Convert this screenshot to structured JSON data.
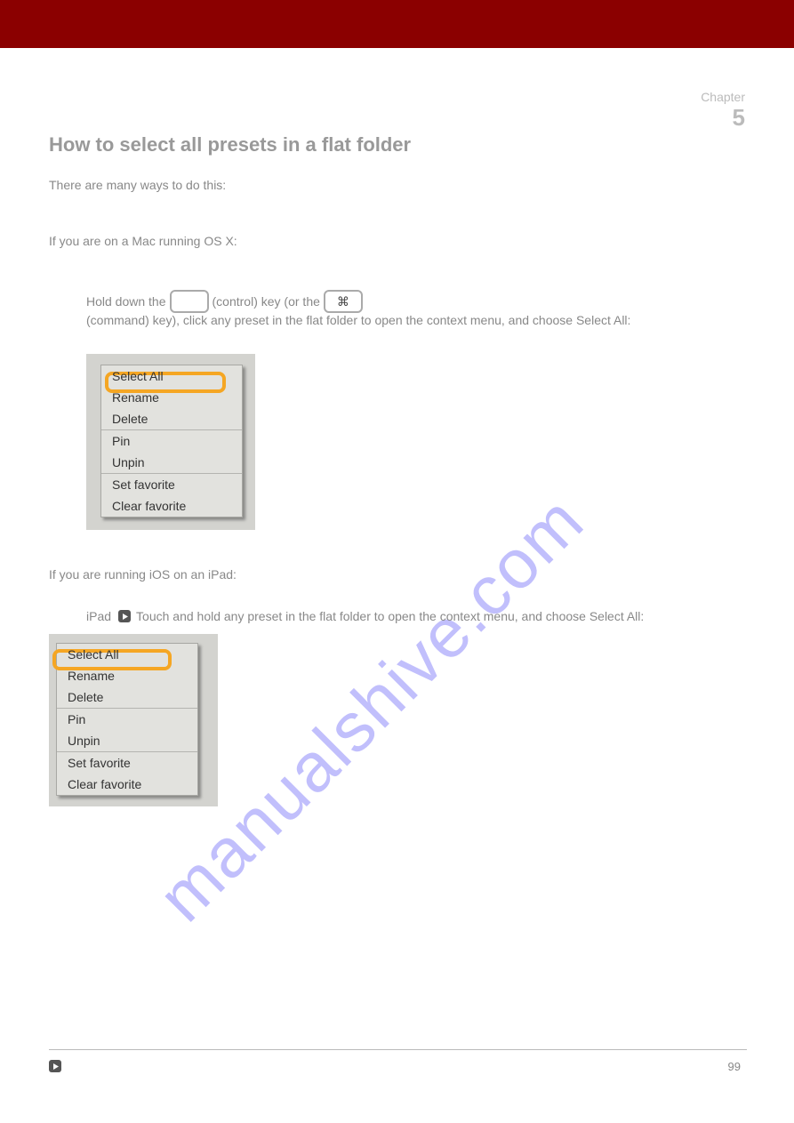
{
  "banner": {},
  "chapter": {
    "label": "Chapter",
    "num": "5"
  },
  "content": {
    "heading": "How to select all presets in a flat folder",
    "intro": "There are many ways to do this:",
    "para_mac": "If you are on a Mac running OS X:",
    "mac_step": "Hold down the ",
    "mac_step_mid": " (control) key (or the ",
    "mac_step_end": " (command) key), click any preset in the flat folder to open the context menu, and choose Select All:",
    "ipad_intro": "If you are running iOS on an iPad:",
    "ipad_toggle_label": "iPad",
    "ipad_step": "Touch and hold any preset in the flat folder to open the context menu, and choose Select All:",
    "footer_page": "99"
  },
  "keys": {
    "ctrl": "",
    "cmd": "⌘"
  },
  "menu": {
    "select_all": "Select All",
    "rename": "Rename",
    "delete": "Delete",
    "pin": "Pin",
    "unpin": "Unpin",
    "set_fav": "Set favorite",
    "clear_fav": "Clear favorite"
  },
  "watermark": "manualshive.com"
}
